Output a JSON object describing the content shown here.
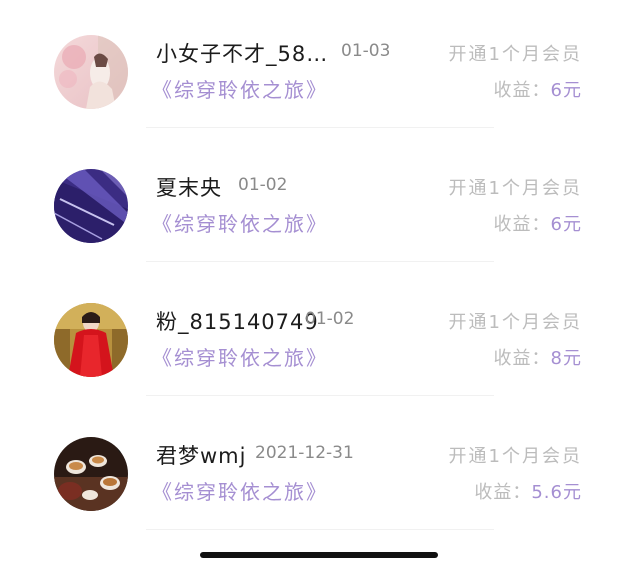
{
  "colors": {
    "accent": "#a58fd2",
    "name_text": "#1c1c1c",
    "date_text": "#8a8a8a",
    "muted_text": "#bcbcbc"
  },
  "records": [
    {
      "name": "小女子不才_58…",
      "date": "01-03",
      "book": "《综穿聆依之旅》",
      "description": "开通1个月会员",
      "income_label": "收益：",
      "income_value": "6元"
    },
    {
      "name": "夏末央",
      "date": "01-02",
      "book": "《综穿聆依之旅》",
      "description": "开通1个月会员",
      "income_label": "收益：",
      "income_value": "6元"
    },
    {
      "name": "粉_815140749",
      "date": "01-02",
      "book": "《综穿聆依之旅》",
      "description": "开通1个月会员",
      "income_label": "收益：",
      "income_value": "8元"
    },
    {
      "name": "君梦wmj",
      "date": "2021-12-31",
      "book": "《综穿聆依之旅》",
      "description": "开通1个月会员",
      "income_label": "收益：",
      "income_value": "5.6元"
    }
  ]
}
